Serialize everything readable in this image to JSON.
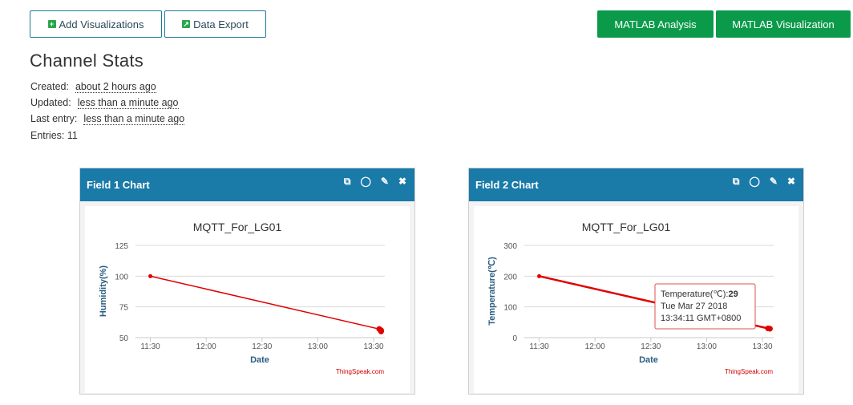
{
  "toolbar": {
    "add_visualizations": "Add Visualizations",
    "data_export": "Data Export",
    "matlab_analysis": "MATLAB Analysis",
    "matlab_visualization": "MATLAB Visualization"
  },
  "stats": {
    "title": "Channel Stats",
    "created_label": "Created:",
    "created_value": "about 2 hours ago",
    "updated_label": "Updated:",
    "updated_value": "less than a minute ago",
    "last_entry_label": "Last entry:",
    "last_entry_value": "less than a minute ago",
    "entries": "Entries: 11"
  },
  "panels": [
    {
      "title": "Field 1 Chart"
    },
    {
      "title": "Field 2 Chart"
    }
  ],
  "tooltip": {
    "line1_label": "Temperature(℃):",
    "line1_value": "29",
    "line2": "Tue Mar 27 2018",
    "line3": "13:34:11 GMT+0800"
  },
  "chart_data": [
    {
      "type": "line",
      "title": "MQTT_For_LG01",
      "xlabel": "Date",
      "ylabel": "Humidity(%)",
      "ylim": [
        50,
        125
      ],
      "yticks": [
        "50",
        "75",
        "100",
        "125"
      ],
      "xticks": [
        "11:30",
        "12:00",
        "12:30",
        "13:00",
        "13:30"
      ],
      "credit": "ThingSpeak.com",
      "color": "#e00000",
      "series": [
        {
          "x": [
            "11:30",
            "13:33",
            "13:33",
            "13:34",
            "13:34",
            "13:34",
            "13:34"
          ],
          "values": [
            100,
            57,
            57,
            56,
            56,
            55,
            55
          ]
        }
      ]
    },
    {
      "type": "line",
      "title": "MQTT_For_LG01",
      "xlabel": "Date",
      "ylabel": "Temperature(℃)",
      "ylim": [
        0,
        300
      ],
      "yticks": [
        "0",
        "100",
        "200",
        "300"
      ],
      "xticks": [
        "11:30",
        "12:00",
        "12:30",
        "13:00",
        "13:30"
      ],
      "credit": "ThingSpeak.com",
      "color": "#e00000",
      "series": [
        {
          "x": [
            "11:30",
            "13:33",
            "13:33",
            "13:34",
            "13:34"
          ],
          "values": [
            200,
            30,
            30,
            29,
            29
          ]
        }
      ]
    }
  ]
}
